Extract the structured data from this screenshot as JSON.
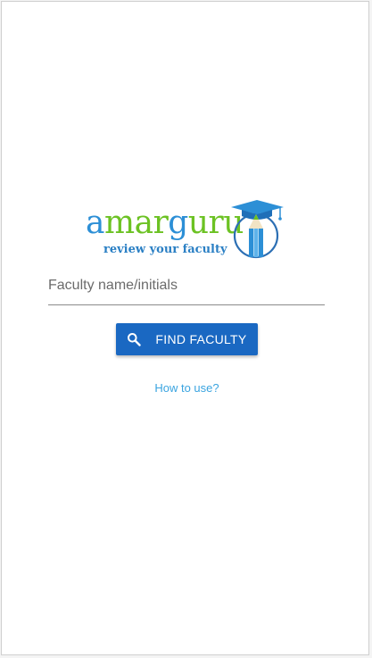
{
  "logo": {
    "word_part1": "a",
    "word_part2": "mar",
    "word_part3": "g",
    "word_part4": "uru",
    "tagline": "review your faculty",
    "icon": "graduation-cap-pencil-icon",
    "colors": {
      "blue": "#2c8fd6",
      "green": "#6cc223",
      "tagline": "#2a7fc4"
    }
  },
  "search": {
    "placeholder": "Faculty name/initials",
    "value": ""
  },
  "find_button": {
    "label": "FIND FACULTY",
    "icon": "search-icon",
    "color": "#1a68c2"
  },
  "help": {
    "label": "How to use?",
    "color": "#3aa4e0"
  }
}
